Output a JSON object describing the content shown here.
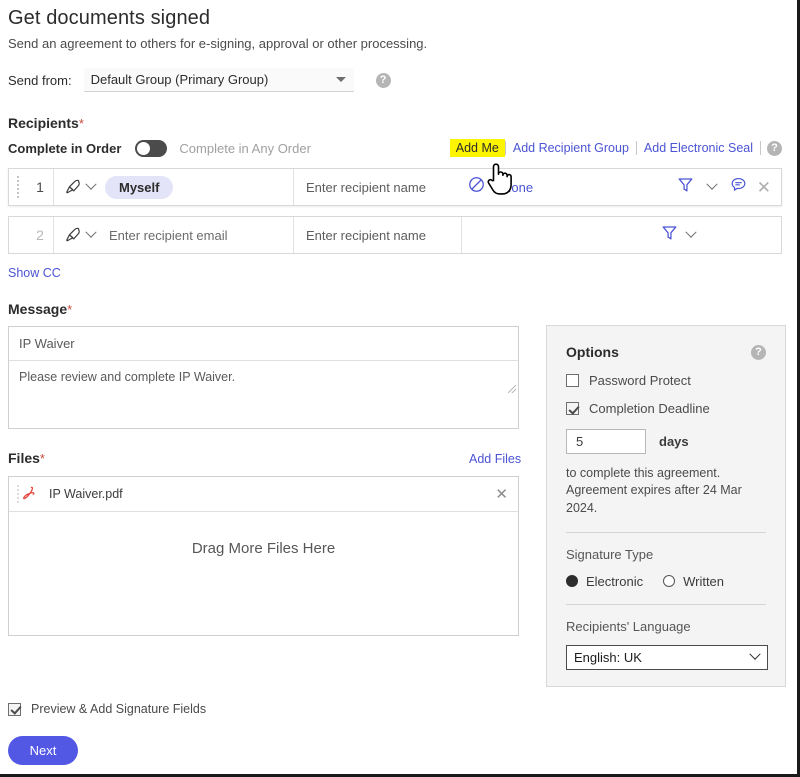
{
  "header": {
    "title": "Get documents signed",
    "subtitle": "Send an agreement to others for e-signing, approval or other processing.",
    "send_from_label": "Send from:",
    "send_from_value": "Default Group (Primary Group)",
    "help_glyph": "?"
  },
  "recipients": {
    "label": "Recipients",
    "required_mark": "*",
    "order_on_label": "Complete in Order",
    "order_off_label": "Complete in Any Order",
    "toggle_state": "off",
    "actions": {
      "add_me": "Add Me",
      "add_me_highlight_color": "#fdf400",
      "add_recipient_group": "Add Recipient Group",
      "add_electronic_seal": "Add Electronic Seal"
    },
    "rows": [
      {
        "number": "1",
        "role_icon": "pen-nib-icon",
        "role_value": "Myself",
        "name_placeholder": "Enter recipient name",
        "auth_icon": "no-entry-icon",
        "auth_value": "None",
        "filter_icon": "funnel-icon",
        "message_icon": "speech-bubble-icon",
        "remove_icon": "close-icon"
      },
      {
        "number": "2",
        "role_icon": "pen-nib-icon",
        "email_placeholder": "Enter recipient email",
        "name_placeholder": "Enter recipient name",
        "filter_icon": "funnel-icon"
      }
    ],
    "show_cc": "Show CC"
  },
  "message": {
    "label": "Message",
    "required_mark": "*",
    "subject_value": "IP Waiver",
    "body_value": "Please review and complete IP Waiver."
  },
  "files": {
    "label": "Files",
    "required_mark": "*",
    "add_files_link": "Add Files",
    "items": [
      {
        "icon": "pdf-icon",
        "name": "IP Waiver.pdf",
        "remove_icon": "close-icon"
      }
    ],
    "drop_text": "Drag More Files Here"
  },
  "options": {
    "title": "Options",
    "help_glyph": "?",
    "password_protect": {
      "label": "Password Protect",
      "checked": false
    },
    "completion_deadline": {
      "label": "Completion Deadline",
      "checked": true
    },
    "days_value": "5",
    "days_unit": "days",
    "note_line_1": "to complete this agreement.",
    "note_line_2": "Agreement expires after 24 Mar 2024.",
    "signature_type_label": "Signature Type",
    "signature_options": [
      {
        "label": "Electronic",
        "selected": true
      },
      {
        "label": "Written",
        "selected": false
      }
    ],
    "language_label": "Recipients' Language",
    "language_value": "English: UK"
  },
  "footer": {
    "preview_label": "Preview & Add Signature Fields",
    "preview_checked": true,
    "next_label": "Next",
    "next_color": "#5258e4"
  }
}
